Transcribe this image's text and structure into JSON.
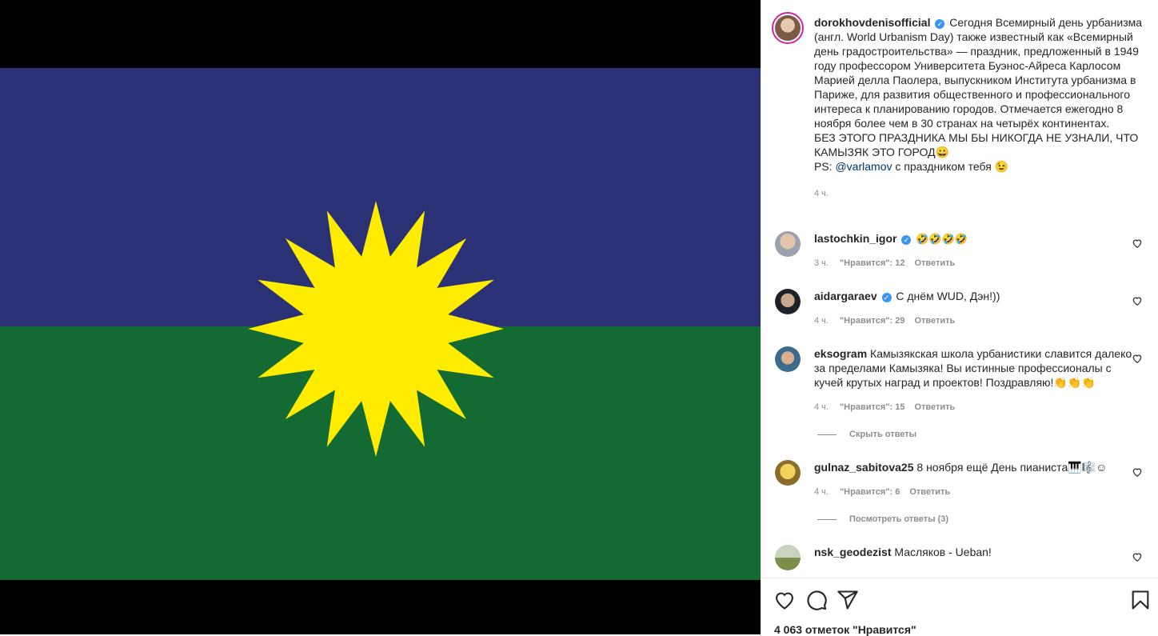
{
  "post": {
    "author": "dorokhovdenisofficial",
    "caption_lines": [
      "Сегодня Всемирный день урбанизма (англ. World Urbanism Day) также известный как «Всемирный день градостроительства» — праздник, предложенный в 1949 году профессором Университета Буэнос-Айреса Карлосом Марией делла Паолера, выпускником Института урбанизма в Париже, для развития общественного и профессионального интереса к планированию городов. Отмечается ежегодно 8 ноября более чем в 30 странах на четырёх континентах.",
      "БЕЗ ЭТОГО ПРАЗДНИКА МЫ БЫ НИКОГДА НЕ УЗНАЛИ, ЧТО КАМЫЗЯК ЭТО ГОРОД😀"
    ],
    "ps_prefix": "PS: ",
    "ps_mention": "@varlamov",
    "ps_suffix": " с праздником тебя 😉",
    "time": "4 ч."
  },
  "comments": [
    {
      "user": "lastochkin_igor",
      "verified": true,
      "text": "🤣🤣🤣🤣",
      "time": "3 ч.",
      "likes": "\"Нравится\": 12",
      "reply": "Ответить"
    },
    {
      "user": "aidargaraev",
      "verified": true,
      "text": "С днём WUD, Дэн!))",
      "time": "4 ч.",
      "likes": "\"Нравится\": 29",
      "reply": "Ответить"
    },
    {
      "user": "eksogram",
      "verified": false,
      "text": "Камызякская школа урбанистики славится далеко за пределами Камызяка! Вы истинные профессионалы с кучей крутых наград и проектов! Поздравляю!👏👏👏",
      "time": "4 ч.",
      "likes": "\"Нравится\": 15",
      "reply": "Ответить"
    },
    {
      "user": "gulnaz_sabitova25",
      "verified": false,
      "text": "8 ноября ещё День пианиста🎹🎼☺",
      "time": "4 ч.",
      "likes": "\"Нравится\": 6",
      "reply": "Ответить"
    },
    {
      "user": "nsk_geodezist",
      "verified": false,
      "text": "Масляков - Ueban!",
      "time": "",
      "likes": "",
      "reply": ""
    }
  ],
  "threads": {
    "hide_replies": "Скрыть ответы",
    "view_replies": "Посмотреть ответы (3)"
  },
  "footer": {
    "likes_count": "4 063 отметок \"Нравится\""
  },
  "colors": {
    "flag_top": "#2b3175",
    "flag_bottom": "#136a33",
    "sun": "#ffec00",
    "verified": "#3897f0"
  },
  "icons": [
    "heart-icon",
    "comment-icon",
    "share-icon",
    "bookmark-icon",
    "like-comment-icon",
    "verified-badge-icon"
  ]
}
